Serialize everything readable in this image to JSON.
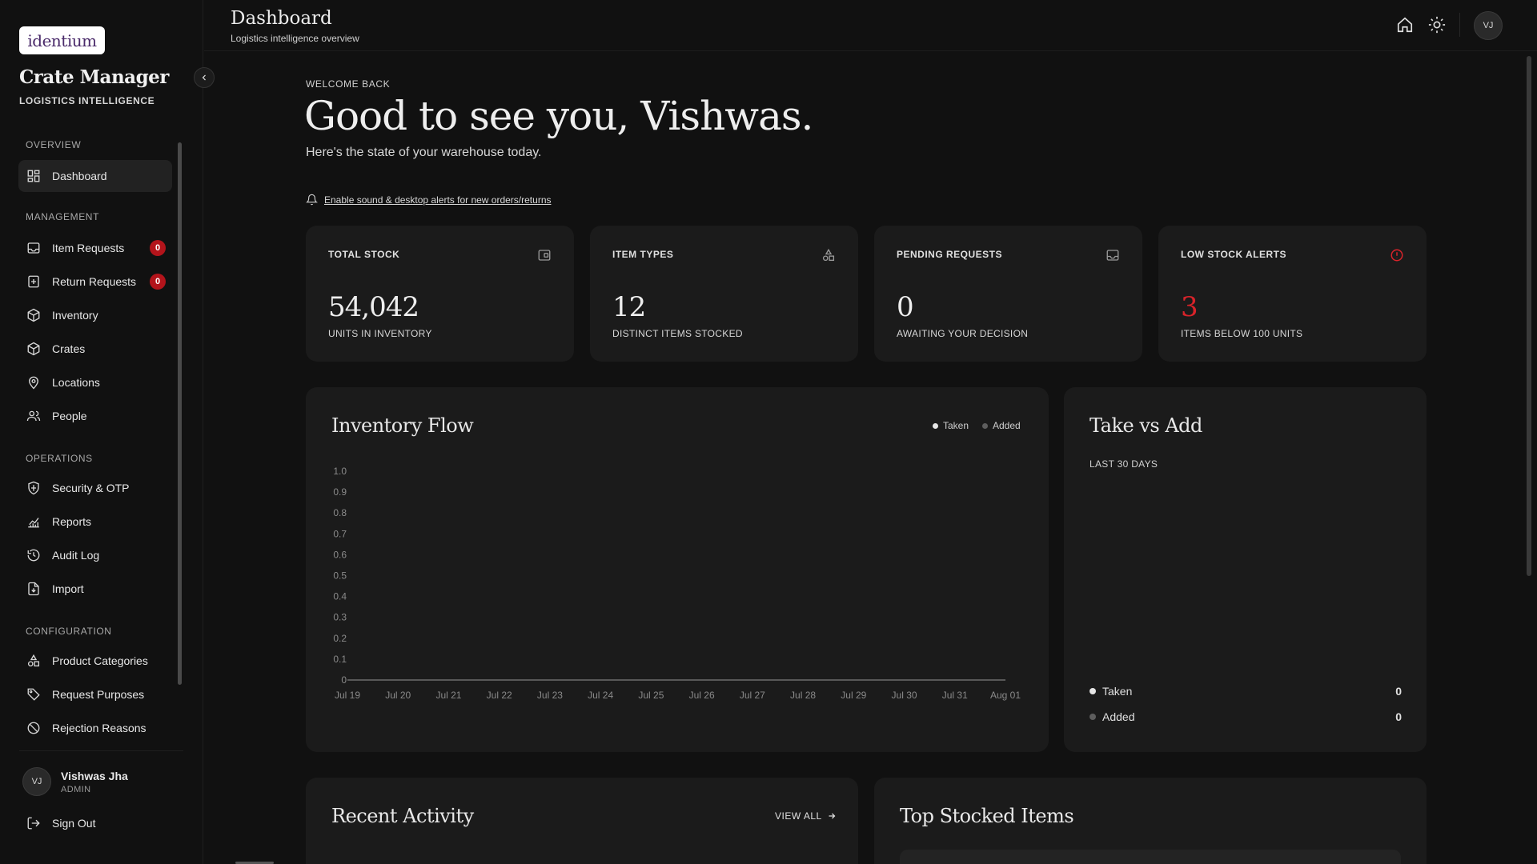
{
  "brand": {
    "logo_text": "identium",
    "app_name": "Crate Manager",
    "app_tagline": "LOGISTICS INTELLIGENCE"
  },
  "sidebar": {
    "sections": [
      {
        "title": "OVERVIEW",
        "items": [
          {
            "label": "Dashboard",
            "icon": "dashboard-icon",
            "active": true
          }
        ]
      },
      {
        "title": "MANAGEMENT",
        "items": [
          {
            "label": "Item Requests",
            "icon": "inbox-icon",
            "badge": "0"
          },
          {
            "label": "Return Requests",
            "icon": "return-icon",
            "badge": "0"
          },
          {
            "label": "Inventory",
            "icon": "box-icon"
          },
          {
            "label": "Crates",
            "icon": "crate-icon"
          },
          {
            "label": "Locations",
            "icon": "map-pin-icon"
          },
          {
            "label": "People",
            "icon": "people-icon"
          }
        ]
      },
      {
        "title": "OPERATIONS",
        "items": [
          {
            "label": "Security & OTP",
            "icon": "shield-icon"
          },
          {
            "label": "Reports",
            "icon": "chart-icon"
          },
          {
            "label": "Audit Log",
            "icon": "history-icon"
          },
          {
            "label": "Import",
            "icon": "file-import-icon"
          }
        ]
      },
      {
        "title": "CONFIGURATION",
        "items": [
          {
            "label": "Product Categories",
            "icon": "shapes-icon"
          },
          {
            "label": "Request Purposes",
            "icon": "tag-icon"
          },
          {
            "label": "Rejection Reasons",
            "icon": "ban-icon"
          }
        ]
      }
    ],
    "user": {
      "initials": "VJ",
      "name": "Vishwas Jha",
      "role": "ADMIN"
    },
    "sign_out": "Sign Out"
  },
  "header": {
    "title": "Dashboard",
    "subtitle": "Logistics intelligence overview",
    "avatar_initials": "VJ"
  },
  "welcome": {
    "kicker": "WELCOME BACK",
    "title": "Good to see you, Vishwas.",
    "subtitle": "Here's the state of your warehouse today.",
    "alert_link": "Enable sound & desktop alerts for new orders/returns"
  },
  "stats": [
    {
      "label": "TOTAL STOCK",
      "value": "54,042",
      "caption": "UNITS IN INVENTORY",
      "icon": "wallet-icon"
    },
    {
      "label": "ITEM TYPES",
      "value": "12",
      "caption": "DISTINCT ITEMS STOCKED",
      "icon": "shapes-icon"
    },
    {
      "label": "PENDING REQUESTS",
      "value": "0",
      "caption": "AWAITING YOUR DECISION",
      "icon": "inbox-icon"
    },
    {
      "label": "LOW STOCK ALERTS",
      "value": "3",
      "caption": "ITEMS BELOW 100 UNITS",
      "icon": "alert-circle-icon"
    }
  ],
  "inventory_flow": {
    "title": "Inventory Flow",
    "legend": [
      "Taken",
      "Added"
    ]
  },
  "take_vs_add": {
    "title": "Take vs Add",
    "kicker": "LAST 30 DAYS",
    "rows": [
      {
        "label": "Taken",
        "value": "0",
        "color": "#e6e6e6"
      },
      {
        "label": "Added",
        "value": "0",
        "color": "#6a6a6a"
      }
    ]
  },
  "recent_activity": {
    "title": "Recent Activity",
    "view_all": "VIEW ALL"
  },
  "top_stocked": {
    "title": "Top Stocked Items"
  },
  "colors": {
    "background": "#111111",
    "card": "#1b1b1b",
    "alert_red": "#d8232a",
    "badge_red": "#b3141b"
  },
  "chart_data": {
    "type": "line",
    "title": "Inventory Flow",
    "x": [
      "Jul 19",
      "Jul 20",
      "Jul 21",
      "Jul 22",
      "Jul 23",
      "Jul 24",
      "Jul 25",
      "Jul 26",
      "Jul 27",
      "Jul 28",
      "Jul 29",
      "Jul 30",
      "Jul 31",
      "Aug 01"
    ],
    "yticks": [
      "0",
      "0.1",
      "0.2",
      "0.3",
      "0.4",
      "0.5",
      "0.6",
      "0.7",
      "0.8",
      "0.9",
      "1.0"
    ],
    "ylim": [
      0,
      1
    ],
    "series": [
      {
        "name": "Taken",
        "values": [
          0,
          0,
          0,
          0,
          0,
          0,
          0,
          0,
          0,
          0,
          0,
          0,
          0,
          0
        ],
        "color": "#e6e6e6"
      },
      {
        "name": "Added",
        "values": [
          0,
          0,
          0,
          0,
          0,
          0,
          0,
          0,
          0,
          0,
          0,
          0,
          0,
          0
        ],
        "color": "#6a6a6a"
      }
    ],
    "grid": false,
    "legend": "top-right"
  }
}
